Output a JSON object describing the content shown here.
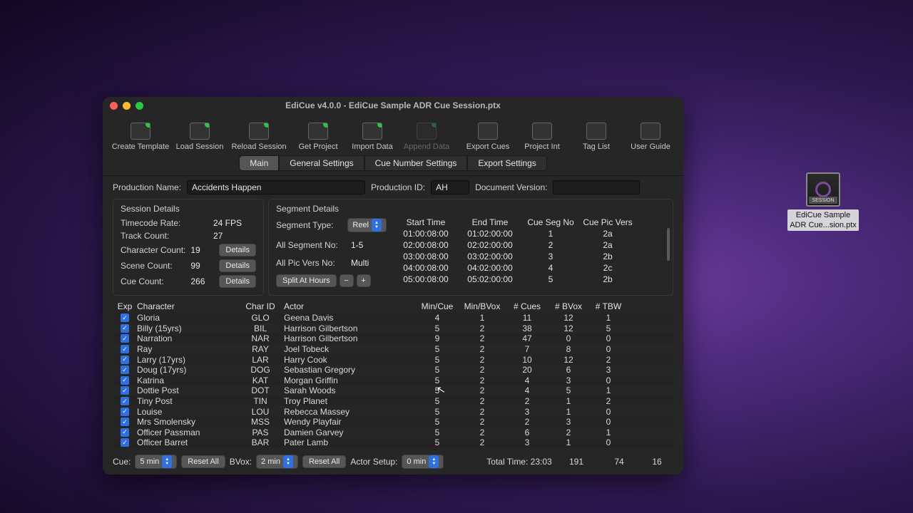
{
  "window": {
    "title": "EdiCue v4.0.0 - EdiCue Sample ADR Cue Session.ptx"
  },
  "desktop": {
    "filename_line1": "EdiCue Sample",
    "filename_line2": "ADR Cue...sion.ptx",
    "banner": "SESSION"
  },
  "toolbar": [
    {
      "label": "Create Template"
    },
    {
      "label": "Load Session"
    },
    {
      "label": "Reload Session"
    },
    {
      "label": "Get Project"
    },
    {
      "label": "Import Data"
    },
    {
      "label": "Append Data"
    },
    {
      "label": "Export Cues"
    },
    {
      "label": "Project Int"
    },
    {
      "label": "Tag List"
    },
    {
      "label": "User Guide"
    }
  ],
  "tabs": [
    "Main",
    "General Settings",
    "Cue Number Settings",
    "Export Settings"
  ],
  "info": {
    "prodname_label": "Production Name:",
    "prodname": "Accidents Happen",
    "prodid_label": "Production ID:",
    "prodid": "AH",
    "docver_label": "Document Version:",
    "docver": ""
  },
  "session": {
    "title": "Session Details",
    "timecode_label": "Timecode Rate:",
    "timecode": "24 FPS",
    "track_label": "Track Count:",
    "track": "27",
    "char_label": "Character Count:",
    "char": "19",
    "scene_label": "Scene Count:",
    "scene": "99",
    "cue_label": "Cue Count:",
    "cue": "266",
    "details_btn": "Details"
  },
  "segment": {
    "title": "Segment Details",
    "type_label": "Segment Type:",
    "type_value": "Reel",
    "allseg_label": "All Segment No:",
    "allseg": "1-5",
    "allpic_label": "All Pic Vers No:",
    "allpic": "Multi",
    "split_btn": "Split At Hours",
    "headers": {
      "start": "Start Time",
      "end": "End Time",
      "segno": "Cue Seg No",
      "picver": "Cue Pic Vers"
    },
    "rows": [
      {
        "start": "01:00:08:00",
        "end": "01:02:00:00",
        "seg": "1",
        "pic": "2a"
      },
      {
        "start": "02:00:08:00",
        "end": "02:02:00:00",
        "seg": "2",
        "pic": "2a"
      },
      {
        "start": "03:00:08:00",
        "end": "03:02:00:00",
        "seg": "3",
        "pic": "2b"
      },
      {
        "start": "04:00:08:00",
        "end": "04:02:00:00",
        "seg": "4",
        "pic": "2c"
      },
      {
        "start": "05:00:08:00",
        "end": "05:02:00:00",
        "seg": "5",
        "pic": "2b"
      }
    ]
  },
  "chars": {
    "headers": {
      "exp": "Exp",
      "character": "Character",
      "charid": "Char ID",
      "actor": "Actor",
      "mincue": "Min/Cue",
      "minbvox": "Min/BVox",
      "ncues": "# Cues",
      "nbvox": "# BVox",
      "ntbw": "# TBW"
    },
    "rows": [
      {
        "c": "Gloria",
        "id": "GLO",
        "a": "Geena Davis",
        "mc": "4",
        "mb": "1",
        "nc": "11",
        "nb": "12",
        "nt": "1"
      },
      {
        "c": "Billy (15yrs)",
        "id": "BIL",
        "a": "Harrison Gilbertson",
        "mc": "5",
        "mb": "2",
        "nc": "38",
        "nb": "12",
        "nt": "5"
      },
      {
        "c": "Narration",
        "id": "NAR",
        "a": "Harrison Gilbertson",
        "mc": "9",
        "mb": "2",
        "nc": "47",
        "nb": "0",
        "nt": "0"
      },
      {
        "c": "Ray",
        "id": "RAY",
        "a": "Joel Tobeck",
        "mc": "5",
        "mb": "2",
        "nc": "7",
        "nb": "8",
        "nt": "0"
      },
      {
        "c": "Larry (17yrs)",
        "id": "LAR",
        "a": "Harry Cook",
        "mc": "5",
        "mb": "2",
        "nc": "10",
        "nb": "12",
        "nt": "2"
      },
      {
        "c": "Doug (17yrs)",
        "id": "DOG",
        "a": "Sebastian Gregory",
        "mc": "5",
        "mb": "2",
        "nc": "20",
        "nb": "6",
        "nt": "3"
      },
      {
        "c": "Katrina",
        "id": "KAT",
        "a": "Morgan Griffin",
        "mc": "5",
        "mb": "2",
        "nc": "4",
        "nb": "3",
        "nt": "0"
      },
      {
        "c": "Dottie Post",
        "id": "DOT",
        "a": "Sarah Woods",
        "mc": "5",
        "mb": "2",
        "nc": "4",
        "nb": "5",
        "nt": "1"
      },
      {
        "c": "Tiny Post",
        "id": "TIN",
        "a": "Troy Planet",
        "mc": "5",
        "mb": "2",
        "nc": "2",
        "nb": "1",
        "nt": "2"
      },
      {
        "c": "Louise",
        "id": "LOU",
        "a": "Rebecca Massey",
        "mc": "5",
        "mb": "2",
        "nc": "3",
        "nb": "1",
        "nt": "0"
      },
      {
        "c": "Mrs Smolensky",
        "id": "MSS",
        "a": "Wendy Playfair",
        "mc": "5",
        "mb": "2",
        "nc": "2",
        "nb": "3",
        "nt": "0"
      },
      {
        "c": "Officer Passman",
        "id": "PAS",
        "a": "Damien Garvey",
        "mc": "5",
        "mb": "2",
        "nc": "6",
        "nb": "2",
        "nt": "1"
      },
      {
        "c": "Officer Barret",
        "id": "BAR",
        "a": "Pater Lamb",
        "mc": "5",
        "mb": "2",
        "nc": "3",
        "nb": "1",
        "nt": "0"
      }
    ]
  },
  "footer": {
    "cue_label": "Cue:",
    "cue_val": "5 min",
    "bvox_label": "BVox:",
    "bvox_val": "2 min",
    "actor_label": "Actor Setup:",
    "actor_val": "0 min",
    "reset": "Reset All",
    "total_label": "Total Time: 23:03",
    "tot_cues": "191",
    "tot_bvox": "74",
    "tot_tbw": "16"
  }
}
